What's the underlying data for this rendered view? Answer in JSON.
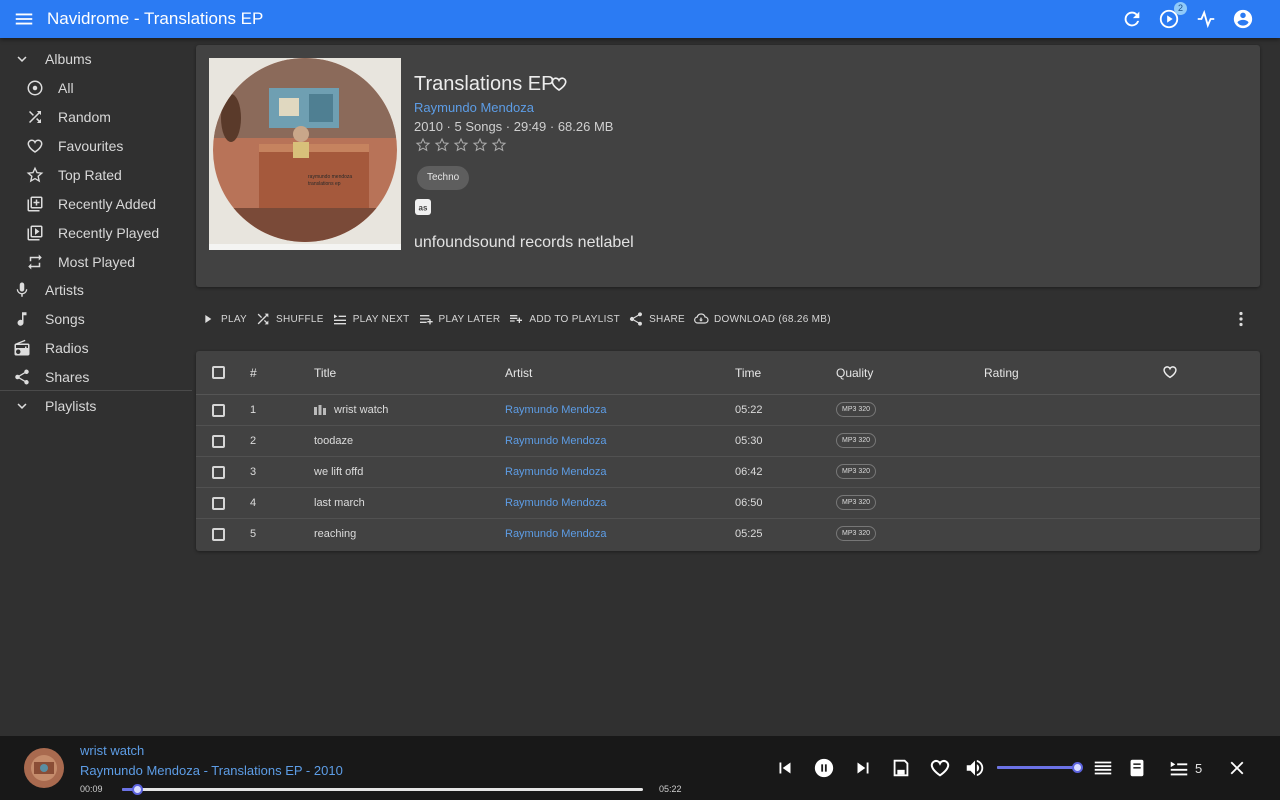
{
  "app": {
    "title": "Navidrome - Translations EP",
    "queue_badge": "2"
  },
  "sidebar": {
    "albums_label": "Albums",
    "album_items": [
      {
        "label": "All",
        "icon": "album-icon"
      },
      {
        "label": "Random",
        "icon": "shuffle-icon"
      },
      {
        "label": "Favourites",
        "icon": "heart-icon"
      },
      {
        "label": "Top Rated",
        "icon": "star-icon"
      },
      {
        "label": "Recently Added",
        "icon": "library-add-icon"
      },
      {
        "label": "Recently Played",
        "icon": "video-library-icon"
      },
      {
        "label": "Most Played",
        "icon": "repeat-icon"
      }
    ],
    "items": [
      {
        "label": "Artists",
        "icon": "mic-icon"
      },
      {
        "label": "Songs",
        "icon": "music-note-icon"
      },
      {
        "label": "Radios",
        "icon": "radio-icon"
      },
      {
        "label": "Shares",
        "icon": "share-icon"
      }
    ],
    "playlists_label": "Playlists"
  },
  "album": {
    "title": "Translations EP",
    "artist": "Raymundo Mendoza",
    "meta": "2010 · 5 Songs · 29:49 · 68.26 MB",
    "rating": 0,
    "rating_max": 5,
    "genre": "Techno",
    "record_label": "unfoundsound records netlabel",
    "cover_text_1": "raymundo mendoza",
    "cover_text_2": "translations ep"
  },
  "toolbar": {
    "play": "PLAY",
    "shuffle": "SHUFFLE",
    "play_next": "PLAY NEXT",
    "play_later": "PLAY LATER",
    "add_to_playlist": "ADD TO PLAYLIST",
    "share": "SHARE",
    "download": "DOWNLOAD (68.26 MB)"
  },
  "table": {
    "headers": {
      "num": "#",
      "title": "Title",
      "artist": "Artist",
      "time": "Time",
      "quality": "Quality",
      "rating": "Rating"
    },
    "rows": [
      {
        "num": "1",
        "title": "wrist watch",
        "artist": "Raymundo Mendoza",
        "time": "05:22",
        "quality": "MP3 320",
        "playing": true
      },
      {
        "num": "2",
        "title": "toodaze",
        "artist": "Raymundo Mendoza",
        "time": "05:30",
        "quality": "MP3 320",
        "playing": false
      },
      {
        "num": "3",
        "title": "we lift offd",
        "artist": "Raymundo Mendoza",
        "time": "06:42",
        "quality": "MP3 320",
        "playing": false
      },
      {
        "num": "4",
        "title": "last march",
        "artist": "Raymundo Mendoza",
        "time": "06:50",
        "quality": "MP3 320",
        "playing": false
      },
      {
        "num": "5",
        "title": "reaching",
        "artist": "Raymundo Mendoza",
        "time": "05:25",
        "quality": "MP3 320",
        "playing": false
      }
    ]
  },
  "player": {
    "song": "wrist watch",
    "subtitle": "Raymundo Mendoza - Translations EP - 2010",
    "current_time": "00:09",
    "duration": "05:22",
    "progress": 0.028,
    "volume": 1.0,
    "queue_count": "5",
    "accent": "#6b72e6"
  },
  "colors": {
    "appbar": "#2b7bf3",
    "link": "#5d9de6",
    "background": "#303030",
    "card": "#424242",
    "player": "#181818"
  }
}
